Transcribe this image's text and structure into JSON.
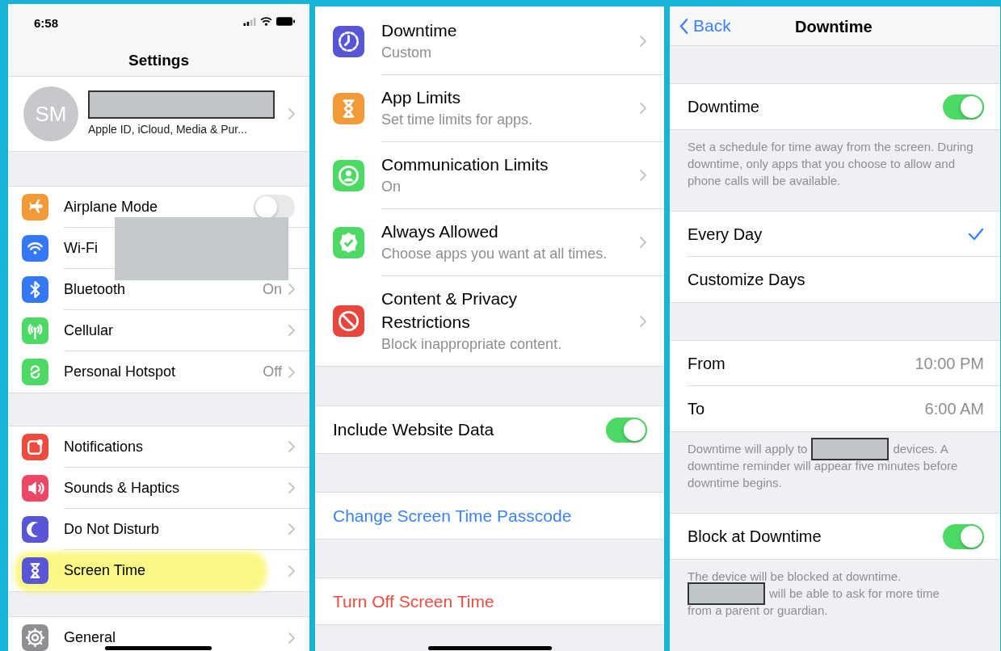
{
  "settings_screen": {
    "status_bar": {
      "time": "6:58"
    },
    "title": "Settings",
    "profile": {
      "initials": "SM",
      "subtitle": "Apple ID, iCloud, Media & Pur...",
      "name_redacted": true
    },
    "groups": [
      [
        {
          "label": "Airplane Mode",
          "color": "#f19a37",
          "kind": "toggle",
          "on": false
        },
        {
          "label": "Wi-Fi",
          "color": "#3478f6",
          "kind": "link",
          "redacted": true
        },
        {
          "label": "Bluetooth",
          "color": "#3478f6",
          "kind": "link",
          "value": "On"
        },
        {
          "label": "Cellular",
          "color": "#4cd964",
          "kind": "link"
        },
        {
          "label": "Personal Hotspot",
          "color": "#4cd964",
          "kind": "link",
          "value": "Off"
        }
      ],
      [
        {
          "label": "Notifications",
          "color": "#ee4b3f",
          "kind": "link"
        },
        {
          "label": "Sounds & Haptics",
          "color": "#ee4766",
          "kind": "link"
        },
        {
          "label": "Do Not Disturb",
          "color": "#5856d6",
          "kind": "link"
        },
        {
          "label": "Screen Time",
          "color": "#5856d6",
          "kind": "link",
          "highlighted": true
        }
      ],
      [
        {
          "label": "General",
          "color": "#8e8e93",
          "kind": "link"
        }
      ]
    ]
  },
  "screen_time_screen": {
    "items": [
      {
        "title": "Downtime",
        "subtitle": "Custom",
        "color": "#5856d6"
      },
      {
        "title": "App Limits",
        "subtitle": "Set time limits for apps.",
        "color": "#f19a37"
      },
      {
        "title": "Communication Limits",
        "subtitle": "On",
        "color": "#4cd964"
      },
      {
        "title": "Always Allowed",
        "subtitle": "Choose apps you want at all times.",
        "color": "#4cd964"
      },
      {
        "title": "Content & Privacy Restrictions",
        "subtitle": "Block inappropriate content.",
        "color": "#e8453c"
      }
    ],
    "website_data": {
      "label": "Include Website Data",
      "on": true
    },
    "actions": [
      {
        "label": "Change Screen Time Passcode",
        "kind": "action"
      },
      {
        "label": "Turn Off Screen Time",
        "kind": "destructive"
      }
    ]
  },
  "downtime_screen": {
    "nav": {
      "back": "Back",
      "title": "Downtime"
    },
    "sections": [
      {
        "rows": [
          {
            "kind": "toggle",
            "label": "Downtime",
            "on": true
          }
        ],
        "footer": [
          [
            {
              "kind": "text",
              "text": "Set a schedule for time away from the screen. During downtime, only apps that you choose to allow and phone calls will be available."
            }
          ]
        ]
      },
      {
        "rows": [
          {
            "kind": "check",
            "label": "Every Day",
            "selected": true
          },
          {
            "kind": "check",
            "label": "Customize Days",
            "selected": false
          }
        ]
      },
      {
        "rows": [
          {
            "kind": "value",
            "label": "From",
            "value": "10:00 PM"
          },
          {
            "kind": "value",
            "label": "To",
            "value": "6:00 AM"
          }
        ],
        "footer": [
          [
            {
              "kind": "text",
              "text": "Downtime will apply to"
            },
            {
              "kind": "redaction"
            },
            {
              "kind": "text",
              "text": "devices. A"
            }
          ],
          [
            {
              "kind": "text",
              "text": "downtime reminder will appear five minutes before downtime begins."
            }
          ]
        ]
      },
      {
        "rows": [
          {
            "kind": "toggle",
            "label": "Block at Downtime",
            "on": true
          }
        ],
        "footer": [
          [
            {
              "kind": "text",
              "text": "The device will be blocked at downtime."
            }
          ],
          [
            {
              "kind": "redaction"
            },
            {
              "kind": "text",
              "text": "will be able to ask for more time"
            }
          ],
          [
            {
              "kind": "text",
              "text": "from a parent or guardian."
            }
          ]
        ]
      }
    ]
  }
}
